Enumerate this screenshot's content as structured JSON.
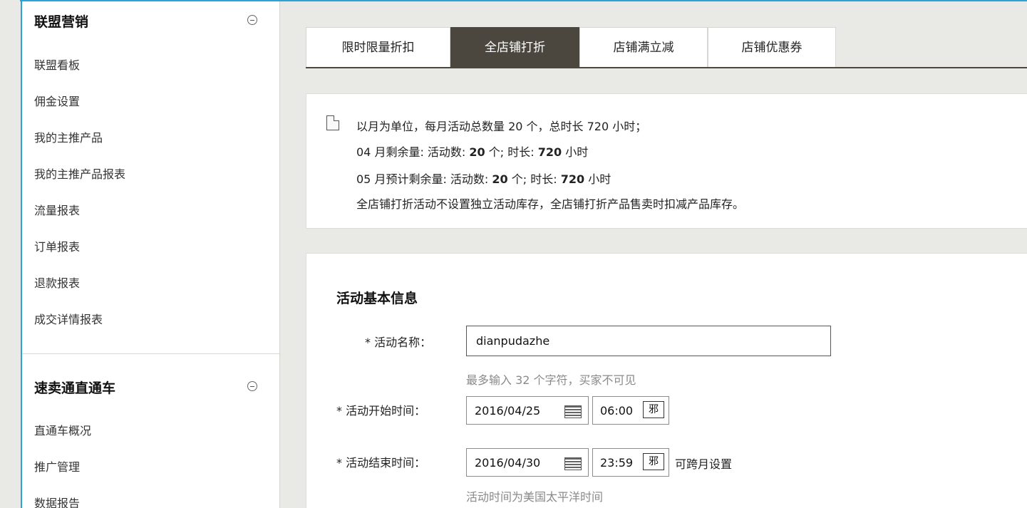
{
  "sidebar": {
    "sections": [
      {
        "title": "联盟营销",
        "items": [
          "联盟看板",
          "佣金设置",
          "我的主推产品",
          "我的主推产品报表",
          "流量报表",
          "订单报表",
          "退款报表",
          "成交详情报表"
        ]
      },
      {
        "title": "速卖通直通车",
        "items": [
          "直通车概况",
          "推广管理",
          "数据报告"
        ]
      }
    ]
  },
  "tabs": [
    {
      "label": "限时限量折扣",
      "active": false
    },
    {
      "label": "全店铺打折",
      "active": true
    },
    {
      "label": "店铺满立减",
      "active": false
    },
    {
      "label": "店铺优惠券",
      "active": false
    }
  ],
  "notice": {
    "line1": "以月为单位，每月活动总数量 20 个，总时长 720 小时；",
    "line2_prefix": "04 月剩余量: 活动数: ",
    "line2_count": "20",
    "line2_mid": " 个; 时长: ",
    "line2_hours": "720",
    "line2_suffix": " 小时",
    "line3_prefix": "05 月预计剩余量: 活动数: ",
    "line3_count": "20",
    "line3_mid": " 个; 时长: ",
    "line3_hours": "720",
    "line3_suffix": " 小时",
    "line4": "全店铺打折活动不设置独立活动库存，全店铺打折产品售卖时扣减产品库存。"
  },
  "form": {
    "title": "活动基本信息",
    "name_label": "* 活动名称：",
    "name_value": "dianpudazhe",
    "name_hint": "最多输入 32 个字符，买家不可见",
    "start_label": "* 活动开始时间：",
    "start_date": "2016/04/25",
    "start_time": "06:00",
    "end_label": "* 活动结束时间：",
    "end_date": "2016/04/30",
    "end_time": "23:59",
    "time_btn": "邪",
    "cross_month": "可跨月设置",
    "time_hint": "活动时间为美国太平洋时间"
  }
}
